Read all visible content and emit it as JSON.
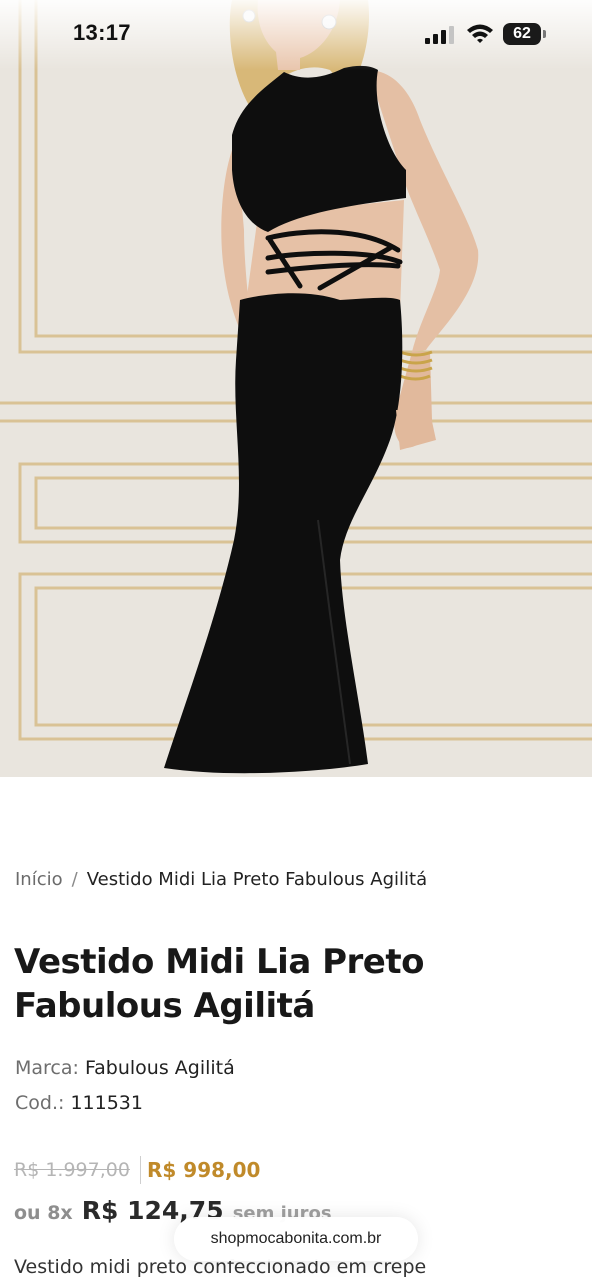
{
  "status_bar": {
    "time": "13:17",
    "battery": "62"
  },
  "hero": {
    "icon": "product-photo-black-cutout-midi-dress"
  },
  "breadcrumb": {
    "home": "Início",
    "separator": "/",
    "current": "Vestido Midi Lia Preto Fabulous Agilitá"
  },
  "product": {
    "title": "Vestido Midi Lia Preto Fabulous Agilitá",
    "brand_label": "Marca:",
    "brand": "Fabulous Agilitá",
    "code_label": "Cod.:",
    "code": "111531",
    "price_old": "R$ 1.997,00",
    "price_new": "R$ 998,00",
    "installment_prefix": "ou 8x",
    "installment_value": "R$ 124,75",
    "installment_suffix": "sem juros",
    "description": "Vestido midi preto confeccionado em crepe"
  },
  "browser": {
    "url": "shopmocabonita.com.br"
  },
  "colors": {
    "sale_price": "#c08a2a",
    "wall": "#e7e3dc",
    "molding_gold": "#d8bf8e",
    "dress": "#0e0e0e"
  }
}
